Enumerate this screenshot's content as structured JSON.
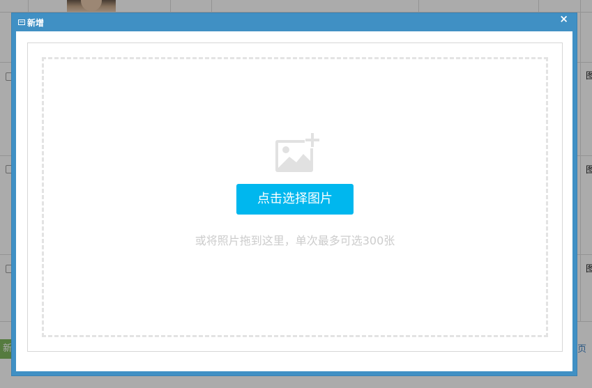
{
  "dialog": {
    "title": "新增",
    "close_glyph": "×"
  },
  "uploader": {
    "button_label": "点击选择图片",
    "hint": "或将照片拖到这里，单次最多可选300张",
    "icon": "image-add-icon"
  },
  "background": {
    "row_cell_text": "图",
    "add_button_label": "新",
    "page_link_label": "页"
  },
  "colors": {
    "dialog_border": "#4090c4",
    "button_bg": "#00b7ee",
    "hint_text": "#cccccc",
    "drop_border": "#e3e3e3"
  }
}
